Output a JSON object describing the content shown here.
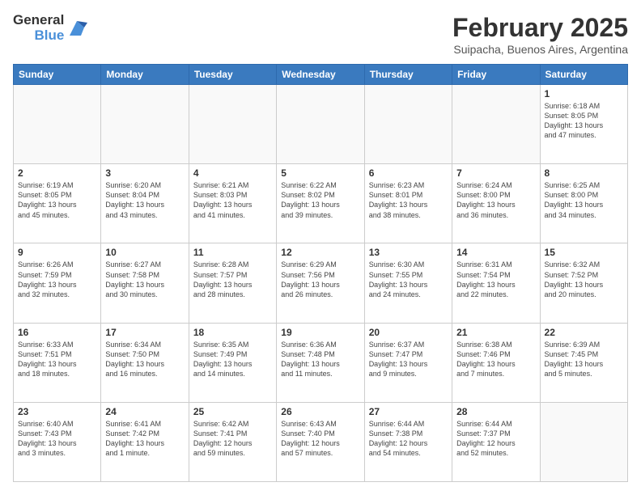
{
  "logo": {
    "general": "General",
    "blue": "Blue"
  },
  "header": {
    "month": "February 2025",
    "location": "Suipacha, Buenos Aires, Argentina"
  },
  "weekdays": [
    "Sunday",
    "Monday",
    "Tuesday",
    "Wednesday",
    "Thursday",
    "Friday",
    "Saturday"
  ],
  "weeks": [
    [
      {
        "day": "",
        "info": ""
      },
      {
        "day": "",
        "info": ""
      },
      {
        "day": "",
        "info": ""
      },
      {
        "day": "",
        "info": ""
      },
      {
        "day": "",
        "info": ""
      },
      {
        "day": "",
        "info": ""
      },
      {
        "day": "1",
        "info": "Sunrise: 6:18 AM\nSunset: 8:05 PM\nDaylight: 13 hours\nand 47 minutes."
      }
    ],
    [
      {
        "day": "2",
        "info": "Sunrise: 6:19 AM\nSunset: 8:05 PM\nDaylight: 13 hours\nand 45 minutes."
      },
      {
        "day": "3",
        "info": "Sunrise: 6:20 AM\nSunset: 8:04 PM\nDaylight: 13 hours\nand 43 minutes."
      },
      {
        "day": "4",
        "info": "Sunrise: 6:21 AM\nSunset: 8:03 PM\nDaylight: 13 hours\nand 41 minutes."
      },
      {
        "day": "5",
        "info": "Sunrise: 6:22 AM\nSunset: 8:02 PM\nDaylight: 13 hours\nand 39 minutes."
      },
      {
        "day": "6",
        "info": "Sunrise: 6:23 AM\nSunset: 8:01 PM\nDaylight: 13 hours\nand 38 minutes."
      },
      {
        "day": "7",
        "info": "Sunrise: 6:24 AM\nSunset: 8:00 PM\nDaylight: 13 hours\nand 36 minutes."
      },
      {
        "day": "8",
        "info": "Sunrise: 6:25 AM\nSunset: 8:00 PM\nDaylight: 13 hours\nand 34 minutes."
      }
    ],
    [
      {
        "day": "9",
        "info": "Sunrise: 6:26 AM\nSunset: 7:59 PM\nDaylight: 13 hours\nand 32 minutes."
      },
      {
        "day": "10",
        "info": "Sunrise: 6:27 AM\nSunset: 7:58 PM\nDaylight: 13 hours\nand 30 minutes."
      },
      {
        "day": "11",
        "info": "Sunrise: 6:28 AM\nSunset: 7:57 PM\nDaylight: 13 hours\nand 28 minutes."
      },
      {
        "day": "12",
        "info": "Sunrise: 6:29 AM\nSunset: 7:56 PM\nDaylight: 13 hours\nand 26 minutes."
      },
      {
        "day": "13",
        "info": "Sunrise: 6:30 AM\nSunset: 7:55 PM\nDaylight: 13 hours\nand 24 minutes."
      },
      {
        "day": "14",
        "info": "Sunrise: 6:31 AM\nSunset: 7:54 PM\nDaylight: 13 hours\nand 22 minutes."
      },
      {
        "day": "15",
        "info": "Sunrise: 6:32 AM\nSunset: 7:52 PM\nDaylight: 13 hours\nand 20 minutes."
      }
    ],
    [
      {
        "day": "16",
        "info": "Sunrise: 6:33 AM\nSunset: 7:51 PM\nDaylight: 13 hours\nand 18 minutes."
      },
      {
        "day": "17",
        "info": "Sunrise: 6:34 AM\nSunset: 7:50 PM\nDaylight: 13 hours\nand 16 minutes."
      },
      {
        "day": "18",
        "info": "Sunrise: 6:35 AM\nSunset: 7:49 PM\nDaylight: 13 hours\nand 14 minutes."
      },
      {
        "day": "19",
        "info": "Sunrise: 6:36 AM\nSunset: 7:48 PM\nDaylight: 13 hours\nand 11 minutes."
      },
      {
        "day": "20",
        "info": "Sunrise: 6:37 AM\nSunset: 7:47 PM\nDaylight: 13 hours\nand 9 minutes."
      },
      {
        "day": "21",
        "info": "Sunrise: 6:38 AM\nSunset: 7:46 PM\nDaylight: 13 hours\nand 7 minutes."
      },
      {
        "day": "22",
        "info": "Sunrise: 6:39 AM\nSunset: 7:45 PM\nDaylight: 13 hours\nand 5 minutes."
      }
    ],
    [
      {
        "day": "23",
        "info": "Sunrise: 6:40 AM\nSunset: 7:43 PM\nDaylight: 13 hours\nand 3 minutes."
      },
      {
        "day": "24",
        "info": "Sunrise: 6:41 AM\nSunset: 7:42 PM\nDaylight: 13 hours\nand 1 minute."
      },
      {
        "day": "25",
        "info": "Sunrise: 6:42 AM\nSunset: 7:41 PM\nDaylight: 12 hours\nand 59 minutes."
      },
      {
        "day": "26",
        "info": "Sunrise: 6:43 AM\nSunset: 7:40 PM\nDaylight: 12 hours\nand 57 minutes."
      },
      {
        "day": "27",
        "info": "Sunrise: 6:44 AM\nSunset: 7:38 PM\nDaylight: 12 hours\nand 54 minutes."
      },
      {
        "day": "28",
        "info": "Sunrise: 6:44 AM\nSunset: 7:37 PM\nDaylight: 12 hours\nand 52 minutes."
      },
      {
        "day": "",
        "info": ""
      }
    ]
  ]
}
